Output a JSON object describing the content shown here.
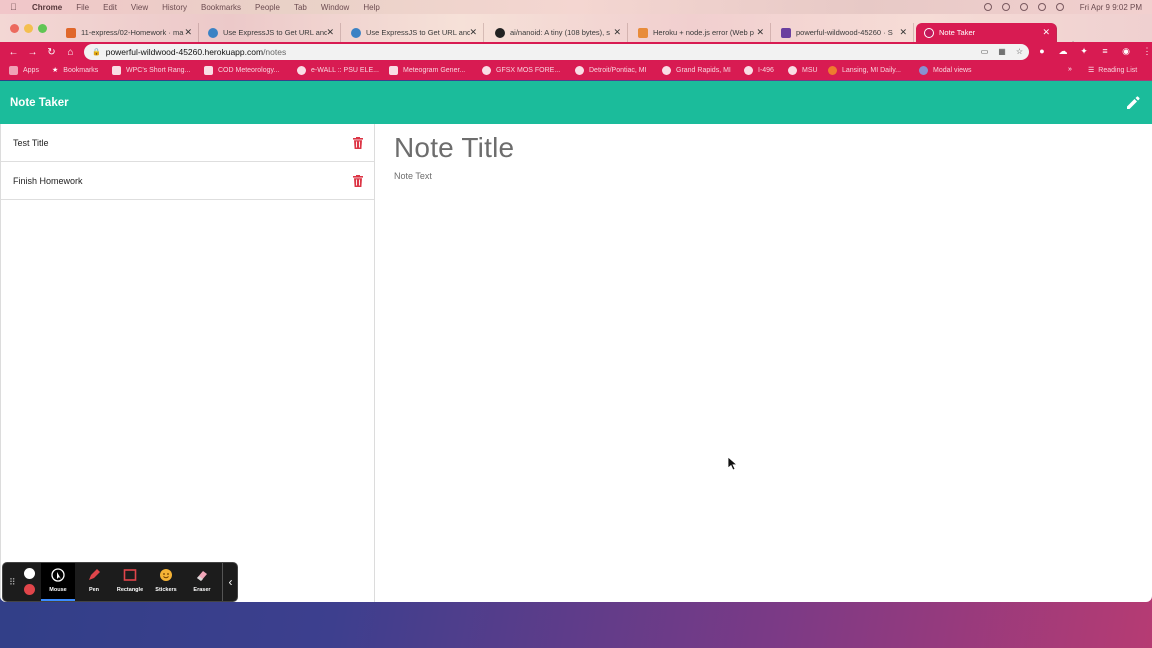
{
  "menubar": {
    "app": "Chrome",
    "menus": [
      "File",
      "Edit",
      "View",
      "History",
      "Bookmarks",
      "People",
      "Tab",
      "Window",
      "Help"
    ],
    "clock": "Fri Apr 9  9:02 PM"
  },
  "tabs": [
    {
      "label": "11-express/02-Homework · ma",
      "favicon_color": "#e0672b"
    },
    {
      "label": "Use ExpressJS to Get URL and",
      "favicon_color": "#3b82c4"
    },
    {
      "label": "Use ExpressJS to Get URL and",
      "favicon_color": "#3b82c4"
    },
    {
      "label": "ai/nanoid: A tiny (108 bytes), s",
      "favicon_color": "#222222"
    },
    {
      "label": "Heroku + node.js error (Web p",
      "favicon_color": "#e88c3a"
    },
    {
      "label": "powerful-wildwood-45260 · S",
      "favicon_color": "#6a3f9f"
    },
    {
      "label": "Note Taker",
      "favicon_color": "#c2185b",
      "active": true
    }
  ],
  "address": {
    "domain": "powerful-wildwood-45260.herokuapp.com",
    "path": "/notes"
  },
  "bookmarks": [
    "Apps",
    "Bookmarks",
    "WPC's Short Rang...",
    "COD Meteorology...",
    "e-WALL :: PSU ELE...",
    "Meteogram Gener...",
    "GFSX MOS FORE...",
    "Detroit/Pontiac, MI",
    "Grand Rapids, MI",
    "I-496",
    "MSU",
    "Lansing, MI Daily...",
    "Modal views",
    "Reading List"
  ],
  "app": {
    "title": "Note Taker",
    "notes": [
      {
        "title": "Test Title"
      },
      {
        "title": "Finish Homework"
      }
    ],
    "editor": {
      "title_placeholder": "Note Title",
      "text_placeholder": "Note Text"
    },
    "colors": {
      "header": "#1bbc9b",
      "delete": "#dc3545",
      "browser_accent": "#d81b52"
    }
  },
  "recorder": {
    "tools": [
      "Mouse",
      "Pen",
      "Rectangle",
      "Stickers",
      "Eraser"
    ],
    "active_tool": "Mouse"
  }
}
